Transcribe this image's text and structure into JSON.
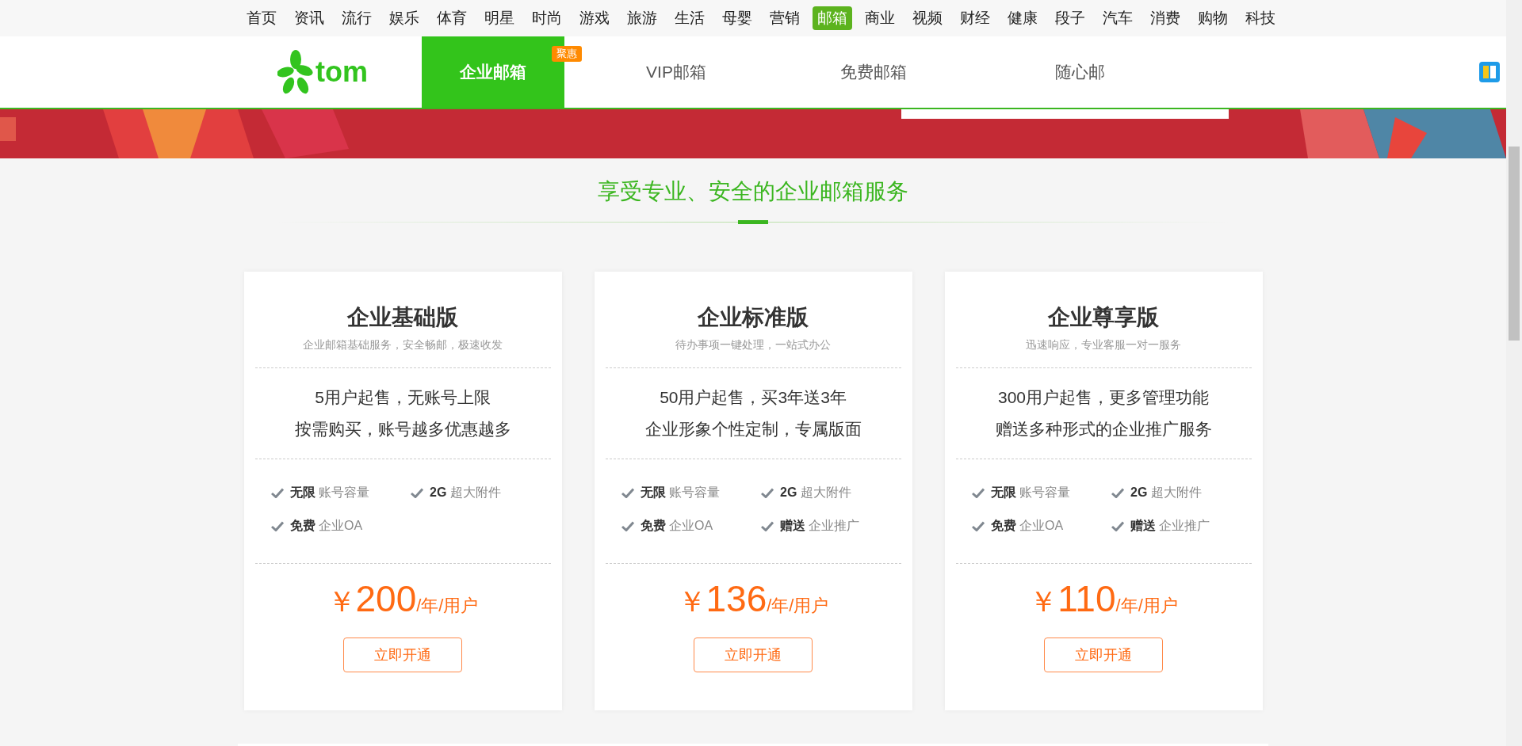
{
  "top_nav": [
    {
      "label": "首页",
      "selected": false
    },
    {
      "label": "资讯",
      "selected": false
    },
    {
      "label": "流行",
      "selected": false
    },
    {
      "label": "娱乐",
      "selected": false
    },
    {
      "label": "体育",
      "selected": false
    },
    {
      "label": "明星",
      "selected": false
    },
    {
      "label": "时尚",
      "selected": false
    },
    {
      "label": "游戏",
      "selected": false
    },
    {
      "label": "旅游",
      "selected": false
    },
    {
      "label": "生活",
      "selected": false
    },
    {
      "label": "母婴",
      "selected": false
    },
    {
      "label": "营销",
      "selected": false
    },
    {
      "label": "邮箱",
      "selected": true
    },
    {
      "label": "商业",
      "selected": false
    },
    {
      "label": "视频",
      "selected": false
    },
    {
      "label": "财经",
      "selected": false
    },
    {
      "label": "健康",
      "selected": false
    },
    {
      "label": "段子",
      "selected": false
    },
    {
      "label": "汽车",
      "selected": false
    },
    {
      "label": "消费",
      "selected": false
    },
    {
      "label": "购物",
      "selected": false
    },
    {
      "label": "科技",
      "selected": false
    }
  ],
  "header": {
    "logo": "tom",
    "tabs": [
      {
        "label": "企业邮箱",
        "selected": true,
        "badge": "聚惠"
      },
      {
        "label": "VIP邮箱",
        "selected": false
      },
      {
        "label": "免费邮箱",
        "selected": false
      },
      {
        "label": "随心邮",
        "selected": false
      }
    ]
  },
  "section_title": "享受专业、安全的企业邮箱服务",
  "plans": [
    {
      "name": "企业基础版",
      "subtitle": "企业邮箱基础服务，安全畅邮，极速收发",
      "highlights": [
        "5用户起售，无账号上限",
        "按需购买，账号越多优惠越多"
      ],
      "features": [
        {
          "key": "无限",
          "text": "账号容量"
        },
        {
          "key": "2G",
          "text": "超大附件"
        },
        {
          "key": "免费",
          "text": "企业OA"
        }
      ],
      "currency": "￥",
      "price": "200",
      "unit": "/年/用户",
      "button": "立即开通"
    },
    {
      "name": "企业标准版",
      "subtitle": "待办事项一键处理，一站式办公",
      "highlights": [
        "50用户起售，买3年送3年",
        "企业形象个性定制，专属版面"
      ],
      "features": [
        {
          "key": "无限",
          "text": "账号容量"
        },
        {
          "key": "2G",
          "text": "超大附件"
        },
        {
          "key": "免费",
          "text": "企业OA"
        },
        {
          "key": "赠送",
          "text": "企业推广"
        }
      ],
      "currency": "￥",
      "price": "136",
      "unit": "/年/用户",
      "button": "立即开通"
    },
    {
      "name": "企业尊享版",
      "subtitle": "迅速响应，专业客服一对一服务",
      "highlights": [
        "300用户起售，更多管理功能",
        "赠送多种形式的企业推广服务"
      ],
      "features": [
        {
          "key": "无限",
          "text": "账号容量"
        },
        {
          "key": "2G",
          "text": "超大附件"
        },
        {
          "key": "免费",
          "text": "企业OA"
        },
        {
          "key": "赠送",
          "text": "企业推广"
        }
      ],
      "currency": "￥",
      "price": "110",
      "unit": "/年/用户",
      "button": "立即开通"
    }
  ]
}
